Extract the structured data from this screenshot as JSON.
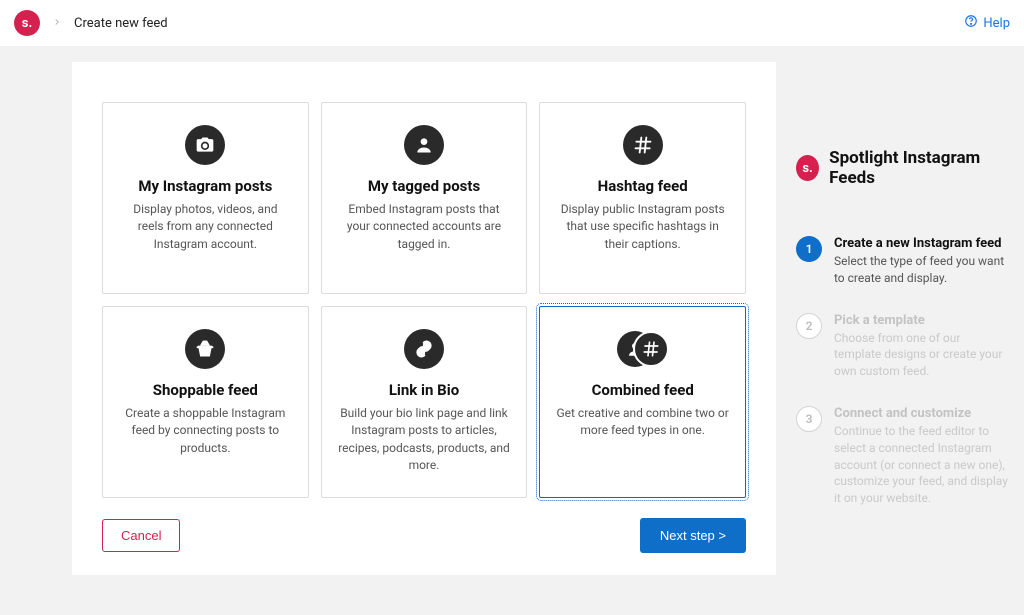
{
  "topbar": {
    "logo_text": "s.",
    "title": "Create new feed",
    "help_label": "Help"
  },
  "cards": [
    {
      "title": "My Instagram posts",
      "desc": "Display photos, videos, and reels from any connected Instagram account.",
      "icon": "camera",
      "selected": false
    },
    {
      "title": "My tagged posts",
      "desc": "Embed Instagram posts that your connected accounts are tagged in.",
      "icon": "person",
      "selected": false
    },
    {
      "title": "Hashtag feed",
      "desc": "Display public Instagram posts that use specific hashtags in their captions.",
      "icon": "hashtag",
      "selected": false
    },
    {
      "title": "Shoppable feed",
      "desc": "Create a shoppable Instagram feed by connecting posts to products.",
      "icon": "basket",
      "selected": false
    },
    {
      "title": "Link in Bio",
      "desc": "Build your bio link page and link Instagram posts to articles, recipes, podcasts, products, and more.",
      "icon": "link",
      "selected": false
    },
    {
      "title": "Combined feed",
      "desc": "Get creative and combine two or more feed types in one.",
      "icon": "combined",
      "selected": true
    }
  ],
  "footer": {
    "cancel_label": "Cancel",
    "next_label": "Next step >"
  },
  "sidebar": {
    "logo_text": "s.",
    "title": "Spotlight Instagram Feeds",
    "steps": [
      {
        "num": "1",
        "title": "Create a new Instagram feed",
        "desc": "Select the type of feed you want to create and display.",
        "active": true
      },
      {
        "num": "2",
        "title": "Pick a template",
        "desc": "Choose from one of our template designs or create your own custom feed.",
        "active": false
      },
      {
        "num": "3",
        "title": "Connect and customize",
        "desc": "Continue to the feed editor to select a connected Instagram account (or connect a new one), customize your feed, and display it on your website.",
        "active": false
      }
    ]
  }
}
